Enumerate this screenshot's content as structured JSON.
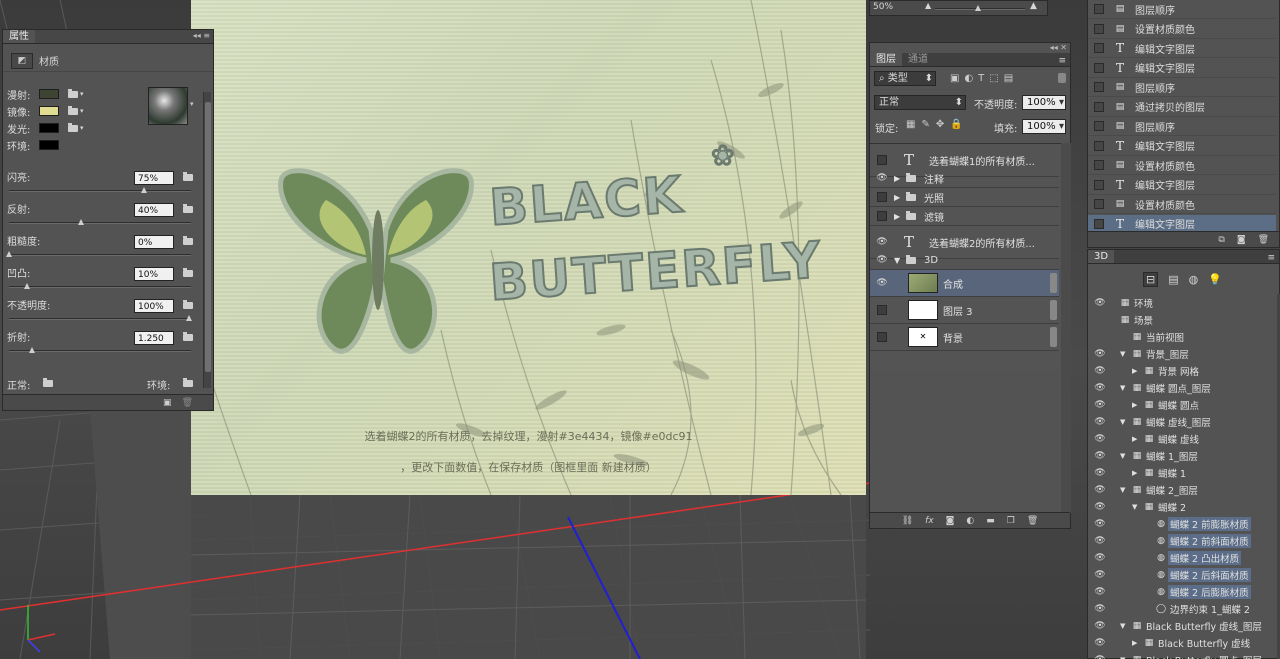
{
  "properties_panel": {
    "tab": "属性",
    "material_label": "材质",
    "rows": [
      {
        "label": "漫射:",
        "color": "#3e4434"
      },
      {
        "label": "镜像:",
        "color": "#e0dc91"
      },
      {
        "label": "发光:",
        "color": "#000000"
      },
      {
        "label": "环境:",
        "color": "#000000"
      }
    ],
    "sliders": [
      {
        "label": "闪亮:",
        "value": "75%",
        "pct": 0.75
      },
      {
        "label": "反射:",
        "value": "40%",
        "pct": 0.4
      },
      {
        "label": "粗糙度:",
        "value": "0%",
        "pct": 0.0
      },
      {
        "label": "凹凸:",
        "value": "10%",
        "pct": 0.1
      },
      {
        "label": "不透明度:",
        "value": "100%",
        "pct": 1.0
      },
      {
        "label": "折射:",
        "value": "1.250",
        "pct": 0.125
      }
    ],
    "normal_label": "正常:",
    "env_label": "环境:"
  },
  "canvas": {
    "caption1": "选着蝴蝶2的所有材质，去掉纹理，漫射#3e4434，镜像#e0dc91",
    "caption2": "，更改下面数值，在保存材质（图框里面 新建材质）",
    "logo_line1": "BLACK",
    "logo_line2": "BUTTERFLY"
  },
  "zoom_value": "50%",
  "layers_panel": {
    "tabs": [
      "图层",
      "通道"
    ],
    "filter_label": "类型",
    "blend_mode": "正常",
    "opacity_label": "不透明度:",
    "opacity_value": "100%",
    "lock_label": "锁定:",
    "fill_label": "填充:",
    "fill_value": "100%",
    "layers": [
      {
        "name": "选着蝴蝶1的所有材质...",
        "kind": "text",
        "visible": false
      },
      {
        "name": "注释",
        "kind": "group",
        "visible": true
      },
      {
        "name": "光照",
        "kind": "group",
        "visible": false
      },
      {
        "name": "滤镜",
        "kind": "group",
        "visible": false
      },
      {
        "name": "选着蝴蝶2的所有材质...",
        "kind": "text",
        "visible": true
      },
      {
        "name": "3D",
        "kind": "group-open",
        "visible": true
      },
      {
        "name": "合成",
        "kind": "3d",
        "visible": true,
        "selected": true
      },
      {
        "name": "图层 3",
        "kind": "white",
        "visible": false
      },
      {
        "name": "背景",
        "kind": "bg",
        "visible": false
      }
    ]
  },
  "history_panel": {
    "items": [
      {
        "label": "图层顺序",
        "kind": "step"
      },
      {
        "label": "设置材质颜色",
        "kind": "step"
      },
      {
        "label": "编辑文字图层",
        "kind": "text"
      },
      {
        "label": "编辑文字图层",
        "kind": "text"
      },
      {
        "label": "图层顺序",
        "kind": "step"
      },
      {
        "label": "通过拷贝的图层",
        "kind": "step"
      },
      {
        "label": "图层顺序",
        "kind": "step"
      },
      {
        "label": "编辑文字图层",
        "kind": "text"
      },
      {
        "label": "设置材质颜色",
        "kind": "step"
      },
      {
        "label": "编辑文字图层",
        "kind": "text"
      },
      {
        "label": "设置材质颜色",
        "kind": "step"
      },
      {
        "label": "编辑文字图层",
        "kind": "text",
        "selected": true
      }
    ]
  },
  "panel3d": {
    "tab": "3D",
    "items": [
      {
        "label": "环境",
        "indent": 0,
        "eye": true,
        "arrow": ""
      },
      {
        "label": "场景",
        "indent": 0,
        "eye": false,
        "arrow": ""
      },
      {
        "label": "当前视图",
        "indent": 1,
        "eye": false,
        "arrow": ""
      },
      {
        "label": "背景_图层",
        "indent": 1,
        "eye": true,
        "arrow": "▼"
      },
      {
        "label": "背景 网格",
        "indent": 2,
        "eye": true,
        "arrow": "▶"
      },
      {
        "label": "蝴蝶 圆点_图层",
        "indent": 1,
        "eye": true,
        "arrow": "▼"
      },
      {
        "label": "蝴蝶 圆点",
        "indent": 2,
        "eye": true,
        "arrow": "▶"
      },
      {
        "label": "蝴蝶 虚线_图层",
        "indent": 1,
        "eye": true,
        "arrow": "▼"
      },
      {
        "label": "蝴蝶 虚线",
        "indent": 2,
        "eye": true,
        "arrow": "▶"
      },
      {
        "label": "蝴蝶 1_图层",
        "indent": 1,
        "eye": true,
        "arrow": "▼"
      },
      {
        "label": "蝴蝶 1",
        "indent": 2,
        "eye": true,
        "arrow": "▶"
      },
      {
        "label": "蝴蝶 2_图层",
        "indent": 1,
        "eye": true,
        "arrow": "▼"
      },
      {
        "label": "蝴蝶 2",
        "indent": 2,
        "eye": true,
        "arrow": "▼"
      },
      {
        "label": "蝴蝶 2 前膨胀材质",
        "indent": 3,
        "eye": true,
        "arrow": "",
        "selected": true
      },
      {
        "label": "蝴蝶 2 前斜面材质",
        "indent": 3,
        "eye": true,
        "arrow": "",
        "selected": true
      },
      {
        "label": "蝴蝶 2 凸出材质",
        "indent": 3,
        "eye": true,
        "arrow": "",
        "selected": true
      },
      {
        "label": "蝴蝶 2 后斜面材质",
        "indent": 3,
        "eye": true,
        "arrow": "",
        "selected": true
      },
      {
        "label": "蝴蝶 2 后膨胀材质",
        "indent": 3,
        "eye": true,
        "arrow": "",
        "selected": true
      },
      {
        "label": "边界约束 1_蝴蝶 2",
        "indent": 3,
        "eye": true,
        "arrow": ""
      },
      {
        "label": "Black Butterfly 虚线_图层",
        "indent": 1,
        "eye": true,
        "arrow": "▼"
      },
      {
        "label": "Black Butterfly 虚线",
        "indent": 2,
        "eye": true,
        "arrow": "▶"
      },
      {
        "label": "Black Butterfly 圆点_图层",
        "indent": 1,
        "eye": true,
        "arrow": "▼"
      }
    ]
  }
}
